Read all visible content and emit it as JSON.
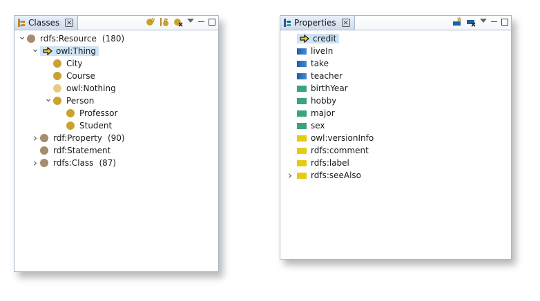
{
  "classes_panel": {
    "title": "Classes",
    "tree": [
      {
        "label": "rdfs:Resource",
        "count": "(180)",
        "indent": 0,
        "arrow": "down",
        "icon": "brown"
      },
      {
        "label": "owl:Thing",
        "count": "",
        "indent": 1,
        "arrow": "down",
        "icon": "pointer",
        "selected": true
      },
      {
        "label": "City",
        "count": "",
        "indent": 2,
        "arrow": "",
        "icon": "gold"
      },
      {
        "label": "Course",
        "count": "",
        "indent": 2,
        "arrow": "",
        "icon": "gold"
      },
      {
        "label": "owl:Nothing",
        "count": "",
        "indent": 2,
        "arrow": "",
        "icon": "pale"
      },
      {
        "label": "Person",
        "count": "",
        "indent": 2,
        "arrow": "down",
        "icon": "gold"
      },
      {
        "label": "Professor",
        "count": "",
        "indent": 3,
        "arrow": "",
        "icon": "gold"
      },
      {
        "label": "Student",
        "count": "",
        "indent": 3,
        "arrow": "",
        "icon": "gold"
      },
      {
        "label": "rdf:Property",
        "count": "(90)",
        "indent": 1,
        "arrow": "right",
        "icon": "brown"
      },
      {
        "label": "rdf:Statement",
        "count": "",
        "indent": 1,
        "arrow": "",
        "icon": "brown"
      },
      {
        "label": "rdfs:Class",
        "count": "(87)",
        "indent": 1,
        "arrow": "right",
        "icon": "brown"
      }
    ]
  },
  "properties_panel": {
    "title": "Properties",
    "tree": [
      {
        "label": "credit",
        "icon": "pointer",
        "arrow": "",
        "selected": true
      },
      {
        "label": "liveIn",
        "icon": "blue",
        "arrow": ""
      },
      {
        "label": "take",
        "icon": "blue",
        "arrow": ""
      },
      {
        "label": "teacher",
        "icon": "blue",
        "arrow": ""
      },
      {
        "label": "birthYear",
        "icon": "green",
        "arrow": ""
      },
      {
        "label": "hobby",
        "icon": "green",
        "arrow": ""
      },
      {
        "label": "major",
        "icon": "green",
        "arrow": ""
      },
      {
        "label": "sex",
        "icon": "green",
        "arrow": ""
      },
      {
        "label": "owl:versionInfo",
        "icon": "yellow",
        "arrow": ""
      },
      {
        "label": "rdfs:comment",
        "icon": "yellow",
        "arrow": ""
      },
      {
        "label": "rdfs:label",
        "icon": "yellow",
        "arrow": ""
      },
      {
        "label": "rdfs:seeAlso",
        "icon": "yellow",
        "arrow": "right"
      }
    ]
  },
  "colors": {
    "selection": "#cde4f7",
    "class_root": "#a68b6f",
    "class_user": "#c9a232",
    "class_nothing": "#e4cc85",
    "object_property": "#1d5fa8",
    "datatype_property": "#3aa57a",
    "annotation_property": "#e6cb15"
  }
}
